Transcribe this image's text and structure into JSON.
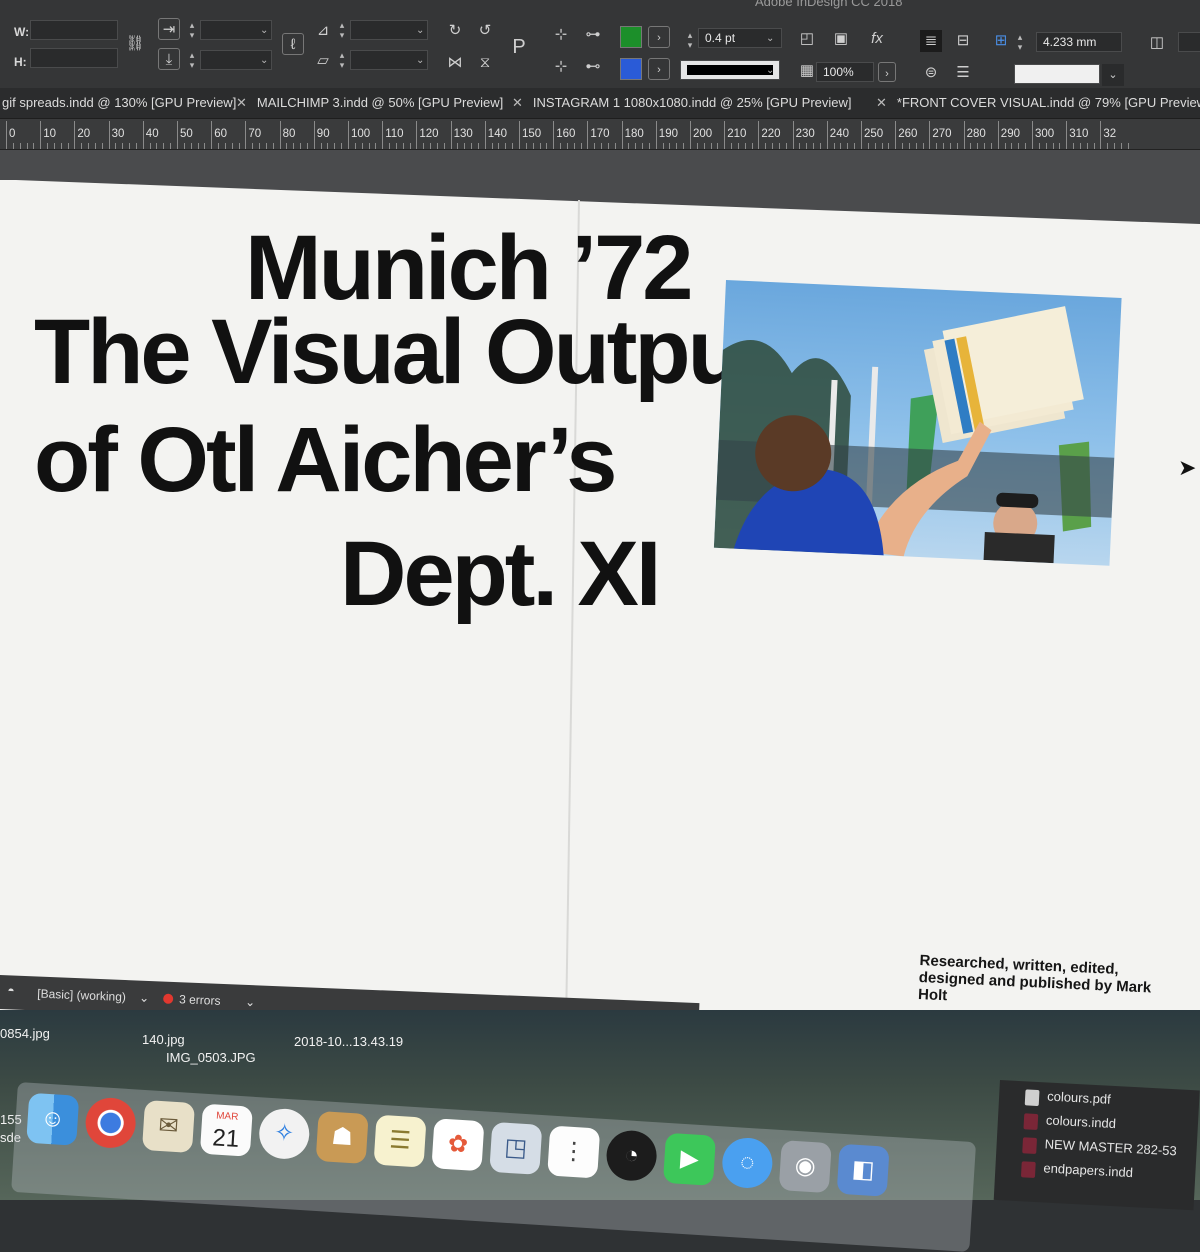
{
  "app": {
    "title": "Adobe InDesign CC 2018"
  },
  "control_panel": {
    "w_label": "W:",
    "h_label": "H:",
    "stroke_weight": "0.4 pt",
    "opacity": "100%",
    "offset": "4.233 mm",
    "colors": {
      "fill": "#1c8f2a",
      "stroke": "#000000",
      "accent": "#2a5bd7"
    }
  },
  "tabs": [
    {
      "label": "gif spreads.indd @ 130% [GPU Preview]",
      "closable": false
    },
    {
      "label": "MAILCHIMP 3.indd @ 50% [GPU Preview]",
      "closable": true
    },
    {
      "label": "INSTAGRAM 1 1080x1080.indd @ 25% [GPU Preview]",
      "closable": true
    },
    {
      "label": "*FRONT COVER VISUAL.indd @ 79% [GPU Preview",
      "closable": true
    }
  ],
  "ruler": [
    "0",
    "10",
    "20",
    "30",
    "40",
    "50",
    "60",
    "70",
    "80",
    "90",
    "100",
    "110",
    "120",
    "130",
    "140",
    "150",
    "160",
    "170",
    "180",
    "190",
    "200",
    "210",
    "220",
    "230",
    "240",
    "250",
    "260",
    "270",
    "280",
    "290",
    "300",
    "310",
    "32"
  ],
  "document": {
    "headline": [
      "Munich ’72",
      "The Visual Output",
      "of Otl Aicher’s",
      "Dept. XI"
    ],
    "credit": "Researched, written, edited, designed and published by Mark Holt"
  },
  "status": {
    "preflight_profile": "[Basic] (working)",
    "errors": "3 errors"
  },
  "desktop": {
    "labels": [
      "0854.jpg",
      "140.jpg",
      "IMG_0503.JPG",
      "2018-10...13.43.19",
      "155",
      "sde"
    ],
    "dock_date": {
      "month": "MAR",
      "day": "21"
    }
  },
  "finder": {
    "files": [
      "colours.pdf",
      "colours.indd",
      "NEW MASTER 282-53",
      "endpapers.indd"
    ]
  }
}
